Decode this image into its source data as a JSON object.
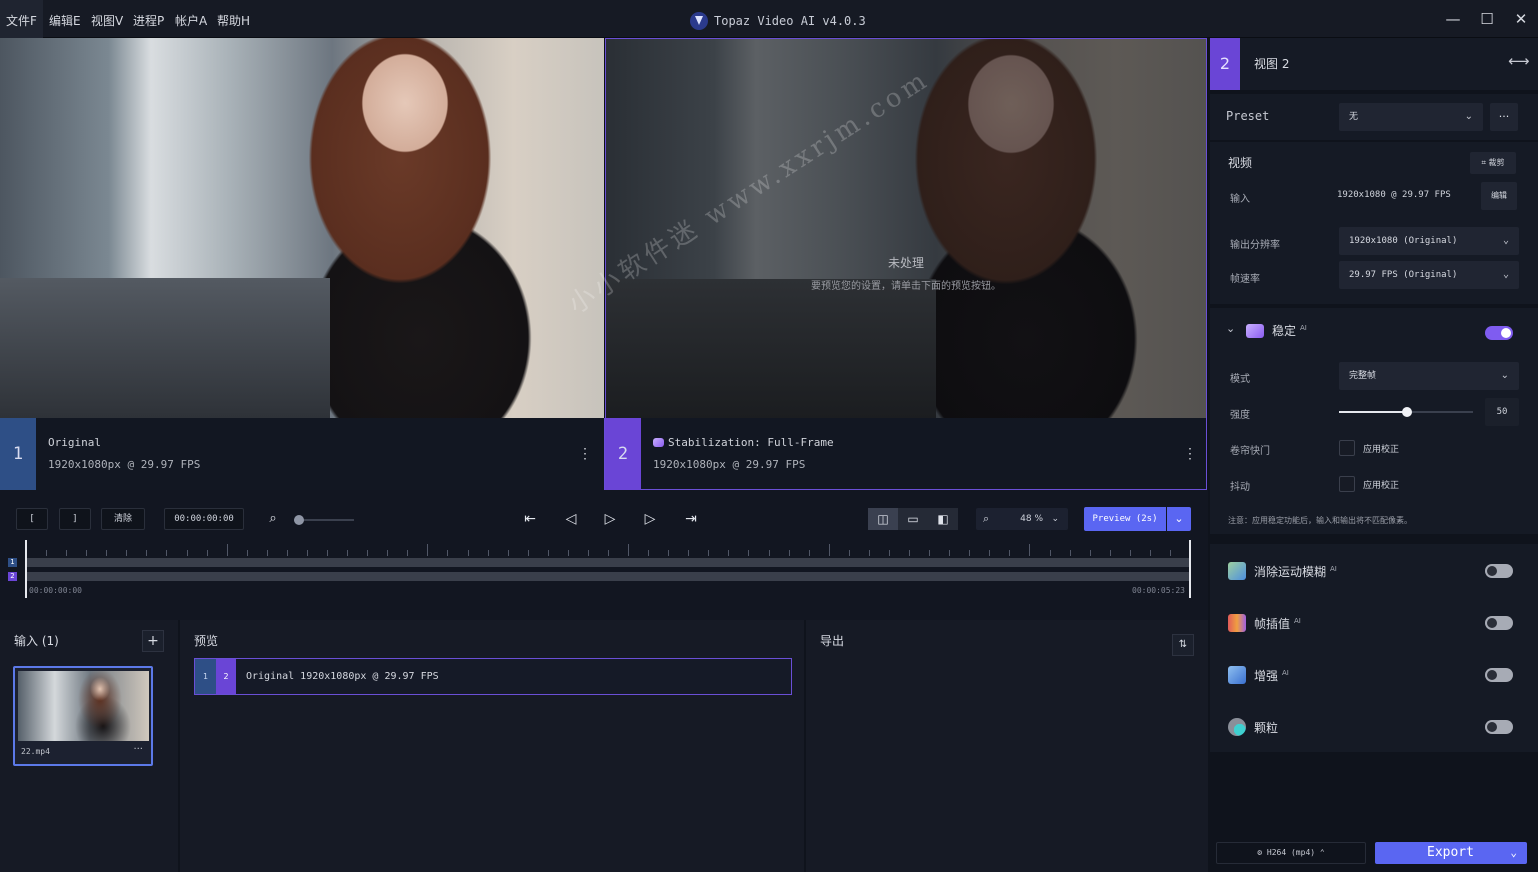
{
  "titlebar": {
    "menus": [
      "文件F",
      "编辑E",
      "视图V",
      "进程P",
      "帐户A",
      "帮助H"
    ],
    "app_title": "Topaz Video AI  v4.0.3",
    "minimize": "—",
    "maximize": "☐",
    "close": "✕"
  },
  "viewer": {
    "pane1": {
      "number": "1",
      "name": "Original",
      "meta": "1920x1080px @ 29.97 FPS"
    },
    "pane2": {
      "number": "2",
      "name": "Stabilization: Full-Frame",
      "meta": "1920x1080px @ 29.97 FPS",
      "unprocessed_title": "未处理",
      "unprocessed_hint": "要预览您的设置，请单击下面的预览按钮。"
    },
    "watermark": "小小软件迷 www.xxrjm.com",
    "menu_dots": "⋮"
  },
  "transport": {
    "in_mark": "[",
    "out_mark": "]",
    "clear": "清除",
    "timecode": "00:00:00:00",
    "zoom": "48 %",
    "preview": "Preview (2s)",
    "start_tc": "00:00:00:00",
    "end_tc": "00:00:05:23"
  },
  "inputs": {
    "title": "输入 (1)",
    "add": "+",
    "file_name": "22.mp4",
    "file_menu": "···"
  },
  "preview_panel": {
    "title": "预览",
    "row_a": "1",
    "row_b": "2",
    "row_text": "Original  1920x1080px @ 29.97 FPS"
  },
  "export_panel": {
    "title": "导出",
    "sort": "⇅"
  },
  "sidebar": {
    "view_number": "2",
    "view_title": "视图 2",
    "swap": "⟷",
    "preset_label": "Preset",
    "preset_value": "无",
    "preset_more": "···",
    "video_title": "视频",
    "crop_label": "裁剪",
    "input_label": "输入",
    "input_value": "1920x1080 @ 29.97 FPS",
    "edit_label": "编辑",
    "output_res_label": "输出分辨率",
    "output_res_value": "1920x1080 (Original)",
    "fps_label": "帧速率",
    "fps_value": "29.97 FPS (Original)",
    "stab_title": "稳定",
    "ai": "AI",
    "mode_label": "模式",
    "mode_value": "完整帧",
    "strength_label": "强度",
    "strength_value": "50",
    "rolling_label": "卷帘快门",
    "rolling_check": "应用校正",
    "jitter_label": "抖动",
    "jitter_check": "应用校正",
    "stab_note": "注意：应用稳定功能后，输入和输出将不匹配像素。",
    "motion_blur": "消除运动模糊",
    "frame_interp": "帧插值",
    "enhance": "增强",
    "grain": "颗粒",
    "codec": "H264 (mp4)",
    "export": "Export"
  },
  "colors": {
    "accent": "#5a66f2",
    "purple": "#7f5cf0",
    "blue_badge": "#2e4f86"
  }
}
